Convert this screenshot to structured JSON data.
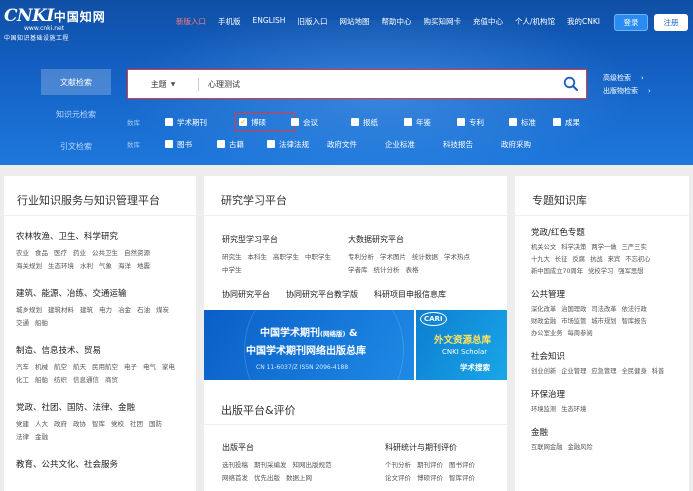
{
  "header": {
    "logo": {
      "brand_latin": "CNKI",
      "brand_cn": "中国知网",
      "url": "www.cnki.net",
      "tagline": "中国知识基础设施工程"
    },
    "nav": [
      {
        "label": "新版入口",
        "active": true
      },
      {
        "label": "手机版"
      },
      {
        "label": "ENGLISH"
      },
      {
        "label": "旧版入口"
      },
      {
        "label": "网站地图"
      },
      {
        "label": "帮助中心"
      },
      {
        "label": "购买知网卡"
      },
      {
        "label": "充值中心"
      },
      {
        "label": "个人/机构馆"
      },
      {
        "label": "我的CNKI"
      }
    ],
    "login_label": "登录",
    "register_label": "注册"
  },
  "side_tabs": [
    {
      "label": "文献检索",
      "active": true
    },
    {
      "label": "知识元检索"
    },
    {
      "label": "引文检索"
    }
  ],
  "search": {
    "field": "主题",
    "query": "心理测试"
  },
  "adv_links": [
    "高级检索",
    "出版物检索"
  ],
  "filters": {
    "row1_label": "数库",
    "row1": [
      {
        "label": "学术期刊",
        "checked": false
      },
      {
        "label": "博硕",
        "checked": true,
        "highlight": true
      },
      {
        "label": "会议",
        "checked": false
      },
      {
        "label": "报纸",
        "checked": false
      },
      {
        "label": "年鉴",
        "checked": false
      },
      {
        "label": "专利",
        "checked": false
      },
      {
        "label": "标准",
        "checked": false
      },
      {
        "label": "成果",
        "checked": false
      }
    ],
    "row2_label": "数库",
    "row2": [
      {
        "label": "图书",
        "checkbox": true
      },
      {
        "label": "古籍",
        "checkbox": true
      },
      {
        "label": "法律法规",
        "checkbox": true
      },
      {
        "label": "政府文件",
        "checkbox": false
      },
      {
        "label": "企业标准",
        "checkbox": false
      },
      {
        "label": "科技报告",
        "checkbox": false
      },
      {
        "label": "政府采购",
        "checkbox": false
      }
    ]
  },
  "left_col": {
    "title": "行业知识服务与知识管理平台",
    "categories": [
      {
        "title": "农林牧渔、卫生、科学研究",
        "items": [
          "农业",
          "食品",
          "医疗",
          "药业",
          "公共卫生",
          "自然资源",
          "海关规划",
          "生态环境",
          "水利",
          "气象",
          "海洋",
          "地震"
        ]
      },
      {
        "title": "建筑、能源、冶练、交通运输",
        "items": [
          "城乡规划",
          "建筑材料",
          "建筑",
          "电力",
          "冶金",
          "石油",
          "煤炭",
          "交通",
          "船舶"
        ]
      },
      {
        "title": "制造、信息技术、贸易",
        "items": [
          "汽车",
          "机械",
          "航空",
          "航天",
          "民用航空",
          "电子",
          "电气",
          "家电",
          "化工",
          "船舶",
          "纺织",
          "信息通信",
          "商贸"
        ]
      },
      {
        "title": "党政、社团、国防、法律、金融",
        "items": [
          "党建",
          "人大",
          "政府",
          "政协",
          "智库",
          "党校",
          "社团",
          "国防",
          "法律",
          "金融"
        ]
      },
      {
        "title": "教育、公共文化、社会服务",
        "items": []
      }
    ]
  },
  "mid_col": {
    "title": "研究学习平台",
    "block1": {
      "heading": "研究型学习平台",
      "items": [
        "研究生",
        "本科生",
        "高职学生",
        "中职学生",
        "中学生"
      ]
    },
    "block2": {
      "heading": "大数据研究平台",
      "items": [
        "专利分析",
        "学术图片",
        "统计数据",
        "学术热点",
        "学者库",
        "统计分析",
        "表格"
      ]
    },
    "row_links": [
      "协同研究平台",
      "协同研究平台教学版",
      "科研项目申报信息库"
    ],
    "banner_left": {
      "line1": "中国学术期刊",
      "line1_small": "(网络版)",
      "line1_tail": " &",
      "line2": "中国学术期刊网络出版总库",
      "line3": "CN 11-6037/Z   ISSN 2096-4188"
    },
    "banner_right": {
      "cari": "CARI",
      "line1": "外文资源总库",
      "line2": "CNKI Scholar",
      "line3": "学术搜索"
    },
    "publish_title": "出版平台&评价",
    "block3": {
      "heading": "出版平台",
      "items": [
        "选刊投稿",
        "期刊采编发",
        "知网出版规范",
        "网络首发",
        "优先出版",
        "数据上网"
      ]
    },
    "block4": {
      "heading": "科研统计与期刊评价",
      "items": [
        "个刊分析",
        "期刊评价",
        "图书评价",
        "论文评价",
        "博硕评价",
        "智库评价"
      ]
    }
  },
  "right_col": {
    "title": "专题知识库",
    "categories": [
      {
        "title": "党政/红色专题",
        "items": [
          "机关公文",
          "科学决策",
          "两学一做",
          "三严三实",
          "十九大",
          "长征",
          "反腐",
          "抗战",
          "来宾",
          "不忘初心",
          "新中国成立70周年",
          "党校学习",
          "强军思想"
        ]
      },
      {
        "title": "公共管理",
        "items": [
          "深化改革",
          "治国理政",
          "司法改革",
          "依法行政",
          "财政金融",
          "市场监管",
          "城市规划",
          "智库报告",
          "办公室业务",
          "每周参阅"
        ]
      },
      {
        "title": "社会知识",
        "items": [
          "创业创新",
          "企业管理",
          "应急管理",
          "全民健身",
          "科普"
        ]
      },
      {
        "title": "环保治理",
        "items": [
          "环境监测",
          "生态环境"
        ]
      },
      {
        "title": "金融",
        "items": [
          "互联网金融",
          "金融风险"
        ]
      }
    ]
  },
  "colors": {
    "brand_blue": "#1461c4",
    "highlight_red": "#e53935",
    "active_nav": "#ff7b7b",
    "check_orange": "#f39200"
  }
}
